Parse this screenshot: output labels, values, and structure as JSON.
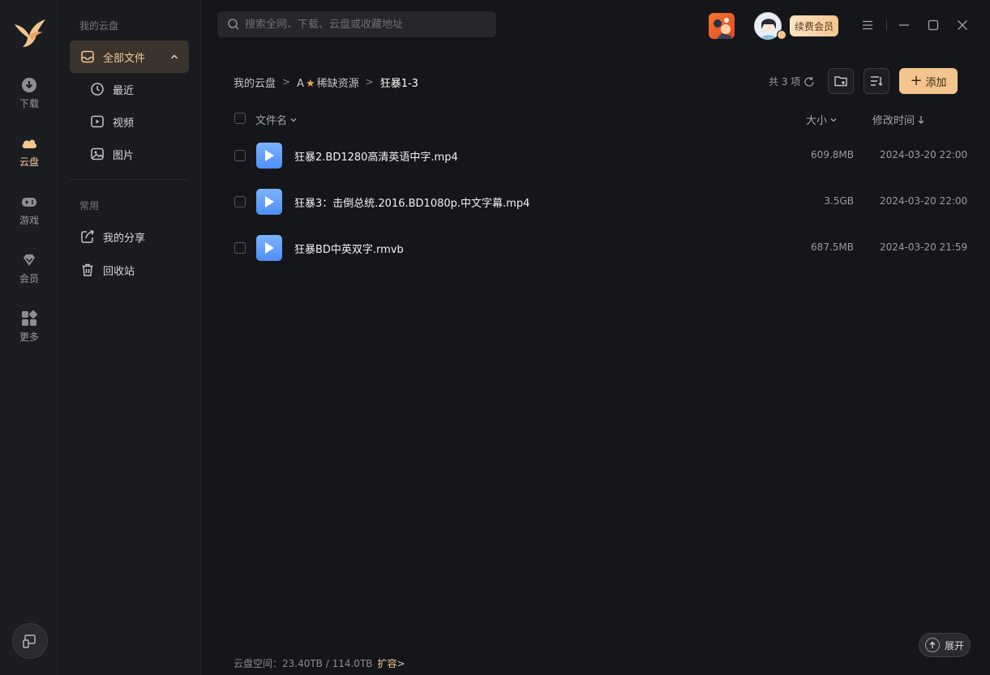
{
  "rail": {
    "items": [
      {
        "label": "下载",
        "icon": "download-icon"
      },
      {
        "label": "云盘",
        "icon": "cloud-icon",
        "active": true
      },
      {
        "label": "游戏",
        "icon": "gamepad-icon"
      },
      {
        "label": "会员",
        "icon": "diamond-icon"
      },
      {
        "label": "更多",
        "icon": "grid-icon"
      }
    ]
  },
  "sidebar": {
    "section_title": "我的云盘",
    "all_files": "全部文件",
    "recent": "最近",
    "video": "视频",
    "image": "图片",
    "common_title": "常用",
    "my_share": "我的分享",
    "recycle": "回收站"
  },
  "topbar": {
    "search_placeholder": "搜索全网、下载、云盘或收藏地址",
    "renew_label": "续费会员"
  },
  "breadcrumb": {
    "root": "我的云盘",
    "folder_prefix": "A",
    "folder_star": "★",
    "folder_name": "稀缺资源",
    "current": "狂暴1-3"
  },
  "toolbar": {
    "count_label": "共 3 项",
    "add_label": "添加"
  },
  "table": {
    "col_name": "文件名",
    "col_size": "大小",
    "col_modified": "修改时间",
    "rows": [
      {
        "name": "狂暴2.BD1280高清英语中字.mp4",
        "size": "609.8MB",
        "modified": "2024-03-20 22:00"
      },
      {
        "name": "狂暴3：击倒总统.2016.BD1080p.中文字幕.mp4",
        "size": "3.5GB",
        "modified": "2024-03-20 22:00"
      },
      {
        "name": "狂暴BD中英双字.rmvb",
        "size": "687.5MB",
        "modified": "2024-03-20 21:59"
      }
    ]
  },
  "footer": {
    "storage_label": "云盘空间：23.40TB / 114.0TB",
    "expand_capacity": "扩容>",
    "expand_button": "展开"
  },
  "colors": {
    "accent": "#f2c79a",
    "background": "#151619",
    "file_icon": "#5a9bfa"
  }
}
